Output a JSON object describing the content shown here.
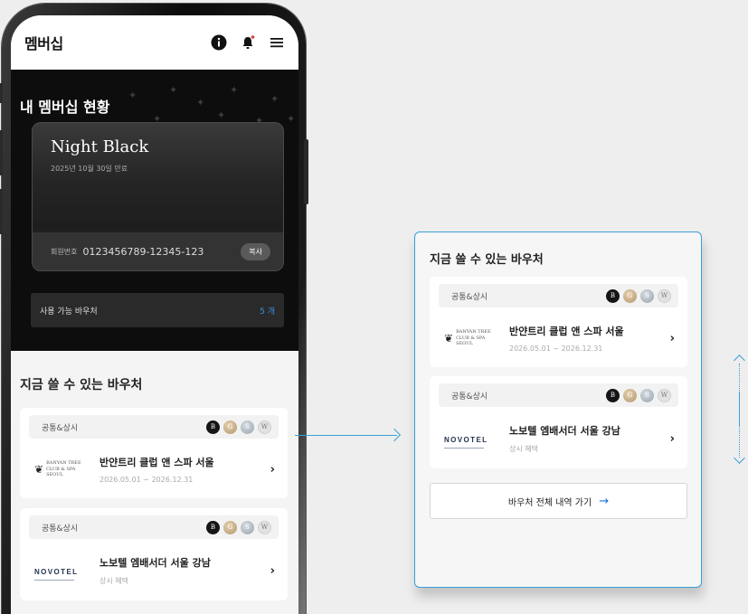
{
  "app": {
    "title": "멤버십",
    "icons": [
      "info-icon",
      "bell-icon",
      "menu-icon"
    ],
    "notification_dot_color": "#e23b3b"
  },
  "membership": {
    "section_title": "내 멤버십 현황",
    "tier": "Night Black",
    "expiry": "2025년 10월 30일 만료",
    "member_label": "회원번호",
    "member_number": "0123456789-12345-123",
    "copy_label": "복사",
    "available_voucher_label": "사용 가능 바우처",
    "available_voucher_count": "5 개"
  },
  "vouchers_section": {
    "title": "지금 쓸 수 있는 바우처",
    "all_button_label": "바우처 전체 내역 가기",
    "all_button_arrow": "→"
  },
  "badges": {
    "black": "B",
    "gold": "G",
    "silver": "S",
    "white": "W"
  },
  "vouchers": [
    {
      "category": "공통&상시",
      "brand_logo": "banyan-tree-logo",
      "logo_text_line1": "BANYAN TREE",
      "logo_text_line2": "CLUB & SPA SEOUL",
      "name": "반얀트리 클럽 앤 스파 서울",
      "sub": "2026.05.01 ~ 2026.12.31",
      "chevron": "›"
    },
    {
      "category": "공통&상시",
      "brand_logo": "novotel-logo",
      "logo_text_line1": "NOVOTEL",
      "logo_text_line2": "",
      "name": "노보텔 엠배서더 서울 강남",
      "sub": "상시 혜택",
      "chevron": "›"
    }
  ],
  "colors": {
    "accent_blue": "#3a9fd8",
    "count_blue": "#3a8ee6",
    "dark_bg": "#0d0d0d"
  }
}
